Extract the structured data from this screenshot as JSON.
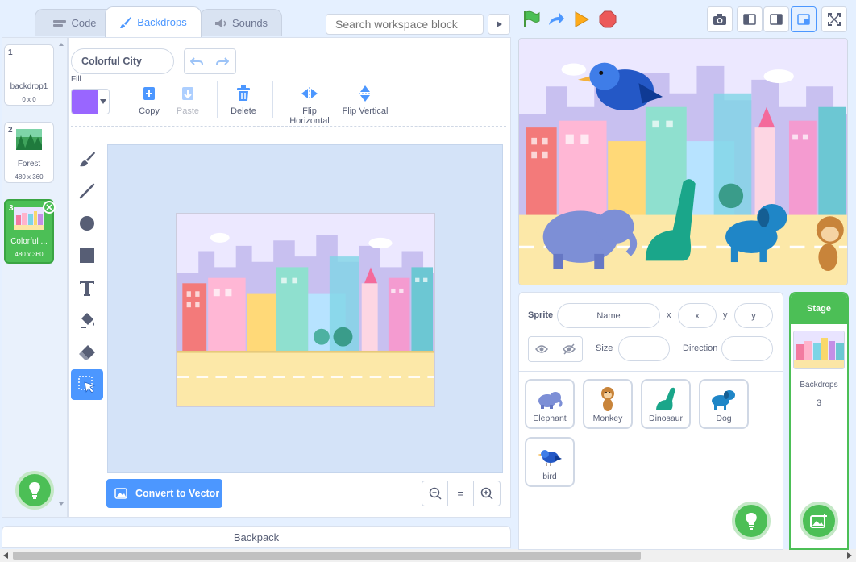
{
  "tabs": [
    {
      "label": "Code",
      "icon": "code-icon"
    },
    {
      "label": "Backdrops",
      "icon": "brush-icon"
    },
    {
      "label": "Sounds",
      "icon": "speaker-icon"
    }
  ],
  "search": {
    "placeholder": "Search workspace block"
  },
  "backdrops": [
    {
      "number": "1",
      "name": "backdrop1",
      "size": "0 x 0"
    },
    {
      "number": "2",
      "name": "Forest",
      "size": "480 x 360"
    },
    {
      "number": "3",
      "name": "Colorful ...",
      "size": "480 x 360",
      "selected": true
    }
  ],
  "editor": {
    "costume_name": "Colorful City",
    "fill_label": "Fill",
    "fill_color": "#9966ff",
    "actions": {
      "copy": "Copy",
      "paste": "Paste",
      "delete": "Delete",
      "flip_h": "Flip Horizontal",
      "flip_v": "Flip Vertical"
    },
    "convert_label": "Convert to Vector",
    "zoom_reset": "="
  },
  "backpack": {
    "label": "Backpack"
  },
  "sprite_info": {
    "sprite_label": "Sprite",
    "name_placeholder": "Name",
    "x_label": "x",
    "x_placeholder": "x",
    "y_label": "y",
    "y_placeholder": "y",
    "size_label": "Size",
    "direction_label": "Direction"
  },
  "sprites": [
    {
      "name": "Elephant",
      "icon": "elephant-icon"
    },
    {
      "name": "Monkey",
      "icon": "monkey-icon"
    },
    {
      "name": "Dinosaur",
      "icon": "dinosaur-icon"
    },
    {
      "name": "Dog",
      "icon": "dog-icon"
    },
    {
      "name": "bird",
      "icon": "bird-icon"
    }
  ],
  "stage_panel": {
    "title": "Stage",
    "backdrops_label": "Backdrops",
    "backdrops_count": "3"
  },
  "colors": {
    "accent": "#4c97ff",
    "green": "#4cbf56",
    "background": "#e5f0ff"
  }
}
